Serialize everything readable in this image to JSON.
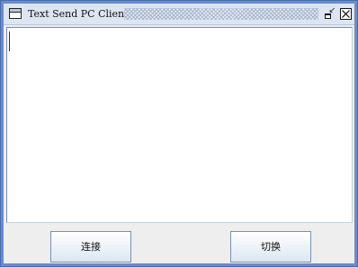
{
  "window": {
    "title": "Text Send PC Client"
  },
  "text_area": {
    "value": ""
  },
  "buttons": {
    "connect_label": "连接",
    "switch_label": "切换"
  },
  "colors": {
    "frame": "#6a8cc8",
    "titlebar": "#dde5f2",
    "content_bg": "#eeeeee"
  }
}
